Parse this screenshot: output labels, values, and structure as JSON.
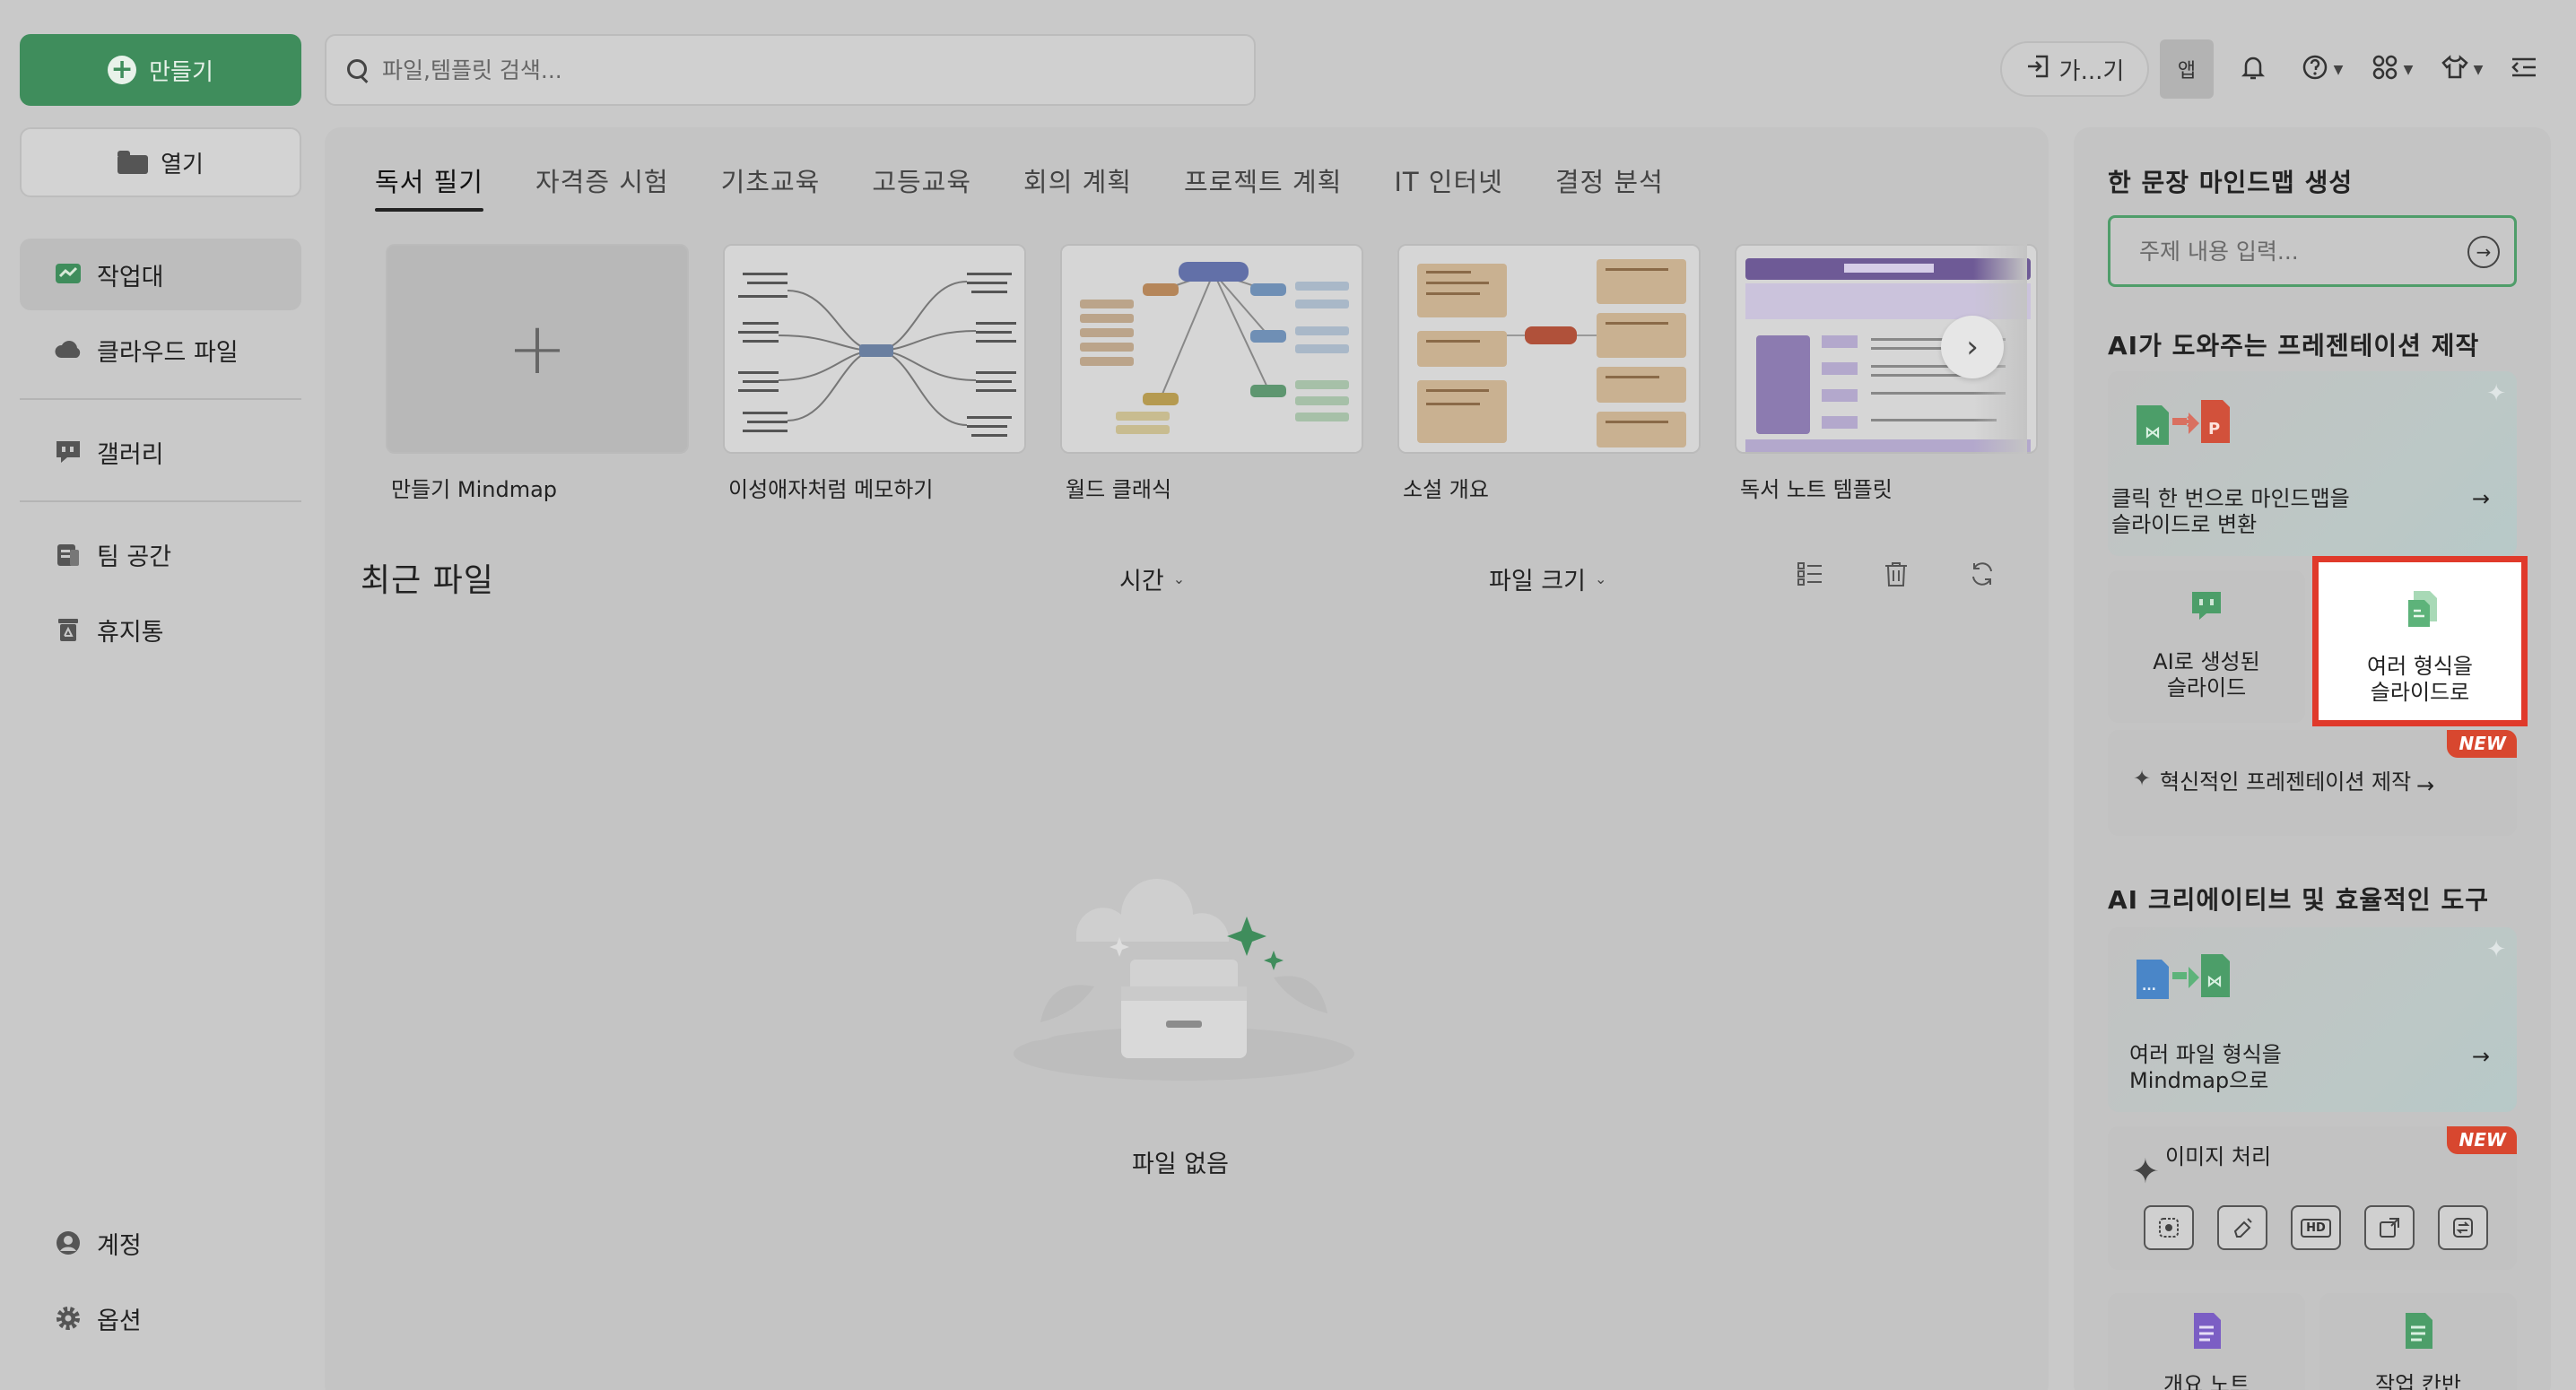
{
  "sidebar": {
    "create_label": "만들기",
    "open_label": "열기",
    "items": [
      {
        "label": "작업대"
      },
      {
        "label": "클라우드 파일"
      },
      {
        "label": "갤러리"
      },
      {
        "label": "팀 공간"
      },
      {
        "label": "휴지통"
      }
    ],
    "account_label": "계정",
    "options_label": "옵션"
  },
  "topbar": {
    "search_placeholder": "파일,템플릿 검색...",
    "gateway_label": "가...기",
    "app_label": "앱"
  },
  "main": {
    "tabs": [
      {
        "label": "독서 필기",
        "active": true
      },
      {
        "label": "자격증 시험"
      },
      {
        "label": "기초교육"
      },
      {
        "label": "고등교육"
      },
      {
        "label": "회의 계획"
      },
      {
        "label": "프로젝트 계획"
      },
      {
        "label": "IT 인터넷"
      },
      {
        "label": "결정 분석"
      }
    ],
    "templates": [
      {
        "label": "만들기 Mindmap"
      },
      {
        "label": "이성애자처럼 메모하기"
      },
      {
        "label": "월드 클래식"
      },
      {
        "label": "소설 개요"
      },
      {
        "label": "독서 노트 템플릿"
      }
    ],
    "recent_title": "최근 파일",
    "sort_time": "시간",
    "sort_size": "파일 크기",
    "empty_text": "파일 없음"
  },
  "right_panel": {
    "mindmap_title": "한 문장 마인드맵 생성",
    "topic_placeholder": "주제 내용 입력...",
    "ai_pres_title": "AI가 도와주는 프레젠테이션 제작",
    "convert_card": {
      "line1": "클릭 한 번으로 마인드맵을",
      "line2": "슬라이드로 변환"
    },
    "ai_slides": {
      "line1": "AI로 생성된",
      "line2": "슬라이드"
    },
    "multi_slides": {
      "line1": "여러 형식을",
      "line2": "슬라이드로"
    },
    "innovative": "혁신적인 프레젠테이션 제작",
    "new_badge": "NEW",
    "ai_tools_title": "AI 크리에이티브 및 효율적인 도구",
    "multi_mindmap": {
      "line1": "여러 파일 형식을",
      "line2": "Mindmap으로"
    },
    "image_processing": "이미지 처리",
    "hd_label": "HD",
    "outline_note": "개요 노트",
    "kanban": "작업 칸반"
  },
  "colors": {
    "brand_green": "#3f8d5c",
    "highlight_red": "#e03a2b",
    "badge_red": "#d8472f"
  }
}
